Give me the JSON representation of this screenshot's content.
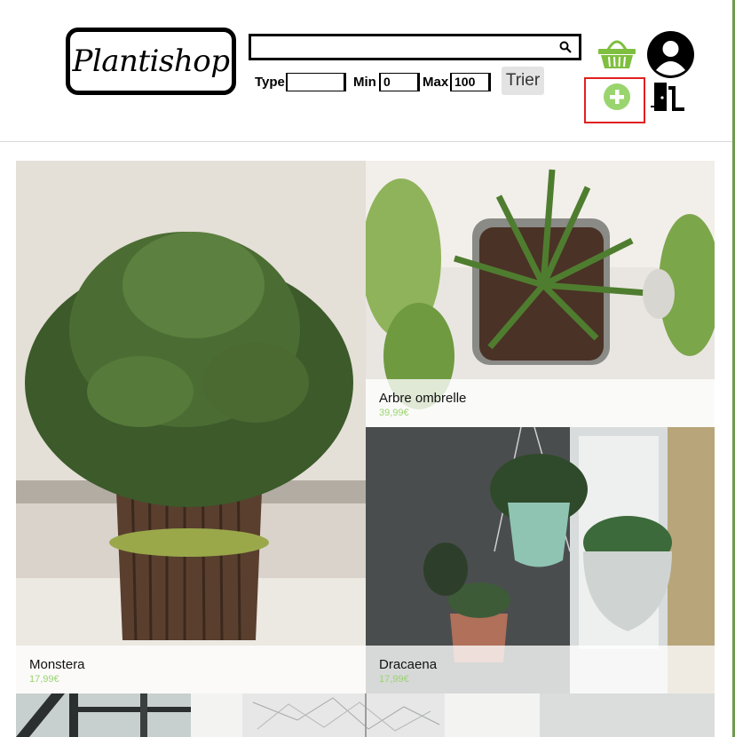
{
  "header": {
    "logo_text": "Plantishop",
    "search": {
      "value": "",
      "icon": "search-icon"
    },
    "filters": {
      "type_label": "Type",
      "type_value": "",
      "min_label": "Min",
      "min_value": "0",
      "max_label": "Max",
      "max_value": "100",
      "sort_button": "Trier"
    },
    "icons": [
      "basket-icon",
      "user-avatar-icon",
      "add-plus-icon",
      "logout-door-icon"
    ],
    "colors": {
      "basket": "#7fbf3f",
      "add": "#9ad46e",
      "highlight": "#e02020"
    }
  },
  "products": [
    {
      "name": "Monstera",
      "price": "17,99€"
    },
    {
      "name": "Arbre ombrelle",
      "price": "39,99€"
    },
    {
      "name": "Dracaena",
      "price": "17,99€"
    }
  ],
  "colors": {
    "price": "#9ad46e",
    "frame": "#6f9a4e"
  }
}
